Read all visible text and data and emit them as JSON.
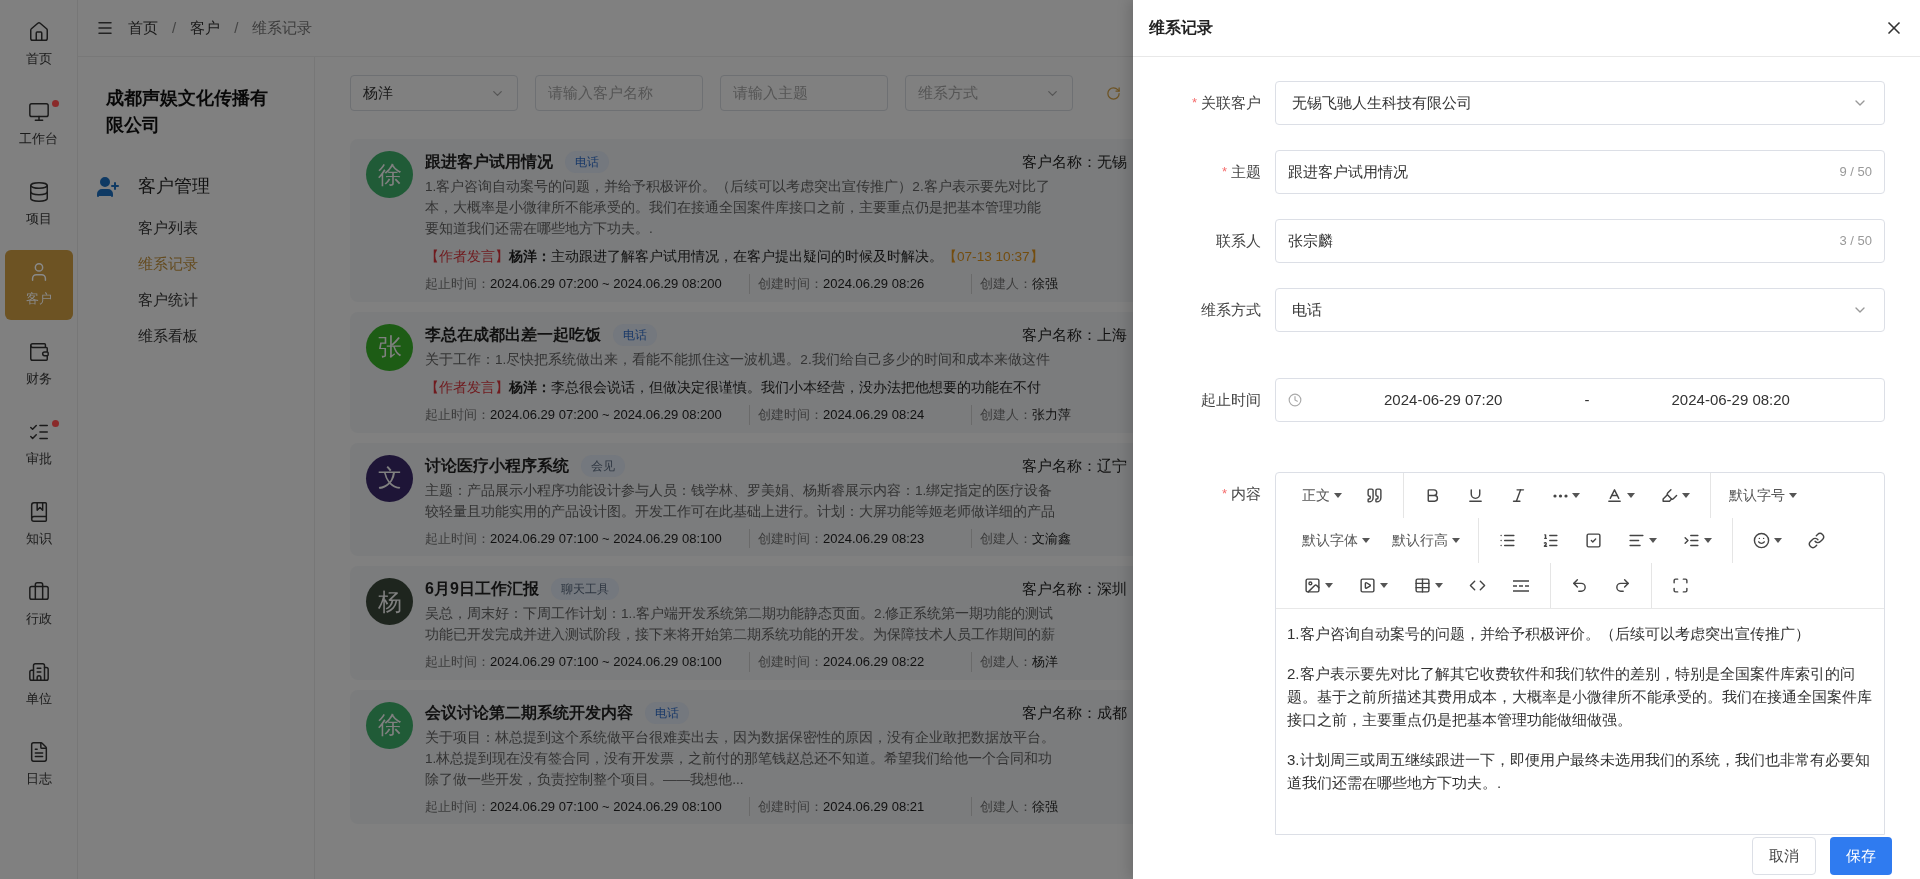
{
  "rail": [
    {
      "label": "首页",
      "selected": false,
      "dot": false
    },
    {
      "label": "工作台",
      "selected": false,
      "dot": true
    },
    {
      "label": "项目",
      "selected": false,
      "dot": false
    },
    {
      "label": "客户",
      "selected": true,
      "dot": false
    },
    {
      "label": "财务",
      "selected": false,
      "dot": false
    },
    {
      "label": "审批",
      "selected": false,
      "dot": true
    },
    {
      "label": "知识",
      "selected": false,
      "dot": false
    },
    {
      "label": "行政",
      "selected": false,
      "dot": false
    },
    {
      "label": "单位",
      "selected": false,
      "dot": false
    },
    {
      "label": "日志",
      "selected": false,
      "dot": false
    }
  ],
  "breadcrumb": {
    "separator": "/",
    "items": [
      "首页",
      "客户",
      "维系记录"
    ]
  },
  "sidebar": {
    "company": "成都声娱文化传播有限公司",
    "section": "客户管理",
    "items": [
      {
        "label": "客户列表",
        "selected": false
      },
      {
        "label": "维系记录",
        "selected": true
      },
      {
        "label": "客户统计",
        "selected": false
      },
      {
        "label": "维系看板",
        "selected": false
      }
    ]
  },
  "filters": [
    {
      "kind": "select",
      "value": "杨洋"
    },
    {
      "kind": "input",
      "placeholder": "请输入客户名称"
    },
    {
      "kind": "input",
      "placeholder": "请输入主题"
    },
    {
      "kind": "select",
      "placeholder": "维系方式"
    }
  ],
  "records": [
    {
      "avatar": "徐",
      "color": "#205b37",
      "title": "跟进客户试用情况",
      "tag": {
        "label": "电话",
        "color": "#183868"
      },
      "customer": "客户名称：无锡",
      "lines": [
        "1.客户咨询自动案号的问题，并给予积极评价。（后续可以考虑突出宣传推广）2.客户表示要先对比了",
        "本，大概率是小微律所不能承受的。我们在接通全国案件库接口之前，主要重点仍是把基本管理功能",
        "要知道我们还需在哪些地方下功夫。."
      ],
      "comment": {
        "tag": "【作者发言】",
        "author": "杨洋：",
        "text": "主动跟进了解客户试用情况，在客户提出疑问的时候及时解决。",
        "time": "【07-13 10:37】"
      },
      "meta": [
        {
          "label": "起止时间：",
          "value": "2024.06.29 07:200 ~ 2024.06.29 08:200"
        },
        {
          "label": "创建时间：",
          "value": "2024.06.29 08:26"
        },
        {
          "label": "创建人：",
          "value": "徐强"
        }
      ]
    },
    {
      "avatar": "张",
      "color": "#1d5c15",
      "title": "李总在成都出差一起吃饭",
      "tag": {
        "label": "电话",
        "color": "#183868"
      },
      "customer": "客户名称：上海",
      "lines": [
        "关于工作：1.尽快把系统做出来，看能不能抓住这一波机遇。2.我们给自己多少的时间和成本来做这件"
      ],
      "comment": {
        "tag": "【作者发言】",
        "author": "杨洋：",
        "text": "李总很会说话，但做决定很谨慎。我们小本经营，没办法把他想要的功能在不付"
      },
      "meta": [
        {
          "label": "起止时间：",
          "value": "2024.06.29 07:200 ~ 2024.06.29 08:200"
        },
        {
          "label": "创建时间：",
          "value": "2024.06.29 08:24"
        },
        {
          "label": "创建人：",
          "value": "张力萍"
        }
      ]
    },
    {
      "avatar": "文",
      "color": "#1e1537",
      "title": "讨论医疗小程序系统",
      "tag": {
        "label": "会见",
        "color": "#2e3641"
      },
      "customer": "客户名称：辽宁",
      "lines": [
        "主题：产品展示小程序功能设计参与人员：钱学林、罗美娟、杨斯睿展示内容：1.绑定指定的医疗设备",
        "较轻量且功能实用的产品设计图。开发工作可在此基础上进行。计划：大屏功能等姬老师做详细的产品"
      ],
      "meta": [
        {
          "label": "起止时间：",
          "value": "2024.06.29 07:100 ~ 2024.06.29 08:100"
        },
        {
          "label": "创建时间：",
          "value": "2024.06.29 08:23"
        },
        {
          "label": "创建人：",
          "value": "文渝鑫"
        }
      ]
    },
    {
      "avatar": "杨",
      "color": "#1e251e",
      "title": "6月9日工作汇报",
      "tag": {
        "label": "聊天工具",
        "color": "#2e3641"
      },
      "customer": "客户名称：深圳",
      "lines": [
        "吴总，周末好：下周工作计划：1..客户端开发系统第二期功能静态页面。2.修正系统第一期功能的测试",
        "功能已开发完成并进入测试阶段，接下来将开始第二期系统功能的开发。为保障技术人员工作期间的薪"
      ],
      "meta": [
        {
          "label": "起止时间：",
          "value": "2024.06.29 07:100 ~ 2024.06.29 08:100"
        },
        {
          "label": "创建时间：",
          "value": "2024.06.29 08:22"
        },
        {
          "label": "创建人：",
          "value": "杨洋"
        }
      ]
    },
    {
      "avatar": "徐",
      "color": "#205b37",
      "title": "会议讨论第二期系统开发内容",
      "tag": {
        "label": "电话",
        "color": "#183868"
      },
      "customer": "客户名称：成都",
      "lines": [
        "关于项目：林总提到这个系统做平台很难卖出去，因为数据保密性的原因，没有企业敢把数据放平台。",
        "1.林总提到现在没有签合同，没有开发票，之前付的那笔钱赵总还不知道。希望我们给他一个合同和功",
        "除了做一些开发，负责控制整个项目。——我想他..."
      ],
      "meta": [
        {
          "label": "起止时间：",
          "value": "2024.06.29 07:100 ~ 2024.06.29 08:100"
        },
        {
          "label": "创建时间：",
          "value": "2024.06.29 08:21"
        },
        {
          "label": "创建人：",
          "value": "徐强"
        }
      ]
    }
  ],
  "drawer": {
    "title": "维系记录",
    "required_symbol": "*",
    "fields": [
      {
        "kind": "select",
        "label": "关联客户",
        "required": true,
        "value": "无锡飞驰人生科技有限公司"
      },
      {
        "kind": "input",
        "label": "主题",
        "required": true,
        "value": "跟进客户试用情况",
        "counter": "9 / 50"
      },
      {
        "kind": "input",
        "label": "联系人",
        "required": false,
        "value": "张宗麟",
        "counter": "3 / 50"
      },
      {
        "kind": "select",
        "label": "维系方式",
        "required": false,
        "value": "电话"
      },
      {
        "kind": "date_range",
        "label": "起止时间",
        "required": false,
        "start": "2024-06-29 07:20",
        "separator": "-",
        "end": "2024-06-29 08:20"
      },
      {
        "kind": "editor",
        "label": "内容",
        "required": true,
        "toolbar": [
          [
            [
              {
                "kind": "text",
                "label": "正文",
                "dropdown": true
              },
              {
                "kind": "icon",
                "dropdown": false
              }
            ],
            [
              {
                "kind": "icon",
                "dropdown": false
              },
              {
                "kind": "icon",
                "dropdown": false
              },
              {
                "kind": "icon",
                "dropdown": false
              },
              {
                "kind": "icon",
                "dropdown": true
              },
              {
                "kind": "icon",
                "dropdown": true
              },
              {
                "kind": "icon",
                "dropdown": true
              }
            ],
            [
              {
                "kind": "text",
                "label": "默认字号",
                "dropdown": true
              }
            ]
          ],
          [
            [
              {
                "kind": "text",
                "label": "默认字体",
                "dropdown": true
              },
              {
                "kind": "text",
                "label": "默认行高",
                "dropdown": true
              }
            ],
            [
              {
                "kind": "icon",
                "dropdown": false
              },
              {
                "kind": "icon",
                "dropdown": false
              },
              {
                "kind": "icon",
                "dropdown": false
              },
              {
                "kind": "icon",
                "dropdown": true
              },
              {
                "kind": "icon",
                "dropdown": true
              }
            ],
            [
              {
                "kind": "icon",
                "dropdown": true
              },
              {
                "kind": "icon",
                "dropdown": false
              }
            ]
          ],
          [
            [
              {
                "kind": "icon",
                "dropdown": true
              },
              {
                "kind": "icon",
                "dropdown": true
              },
              {
                "kind": "icon",
                "dropdown": true
              },
              {
                "kind": "icon",
                "dropdown": false
              },
              {
                "kind": "icon",
                "dropdown": false
              }
            ],
            [
              {
                "kind": "icon",
                "dropdown": false
              },
              {
                "kind": "icon",
                "dropdown": false
              }
            ],
            [
              {
                "kind": "icon",
                "dropdown": false
              }
            ]
          ]
        ],
        "paragraphs": [
          "1.客户咨询自动案号的问题，并给予积极评价。（后续可以考虑突出宣传推广）",
          "2.客户表示要先对比了解其它收费软件和我们软件的差别，特别是全国案件库索引的问题。基于之前所描述其费用成本，大概率是小微律所不能承受的。我们在接通全国案件库接口之前，主要重点仍是把基本管理功能做细做强。",
          "3.计划周三或周五继续跟进一下，即便用户最终未选用我们的系统，我们也非常有必要知道我们还需在哪些地方下功夫。."
        ]
      }
    ],
    "buttons": [
      {
        "label": "取消",
        "kind": "default"
      },
      {
        "label": "保存",
        "kind": "primary"
      }
    ]
  }
}
